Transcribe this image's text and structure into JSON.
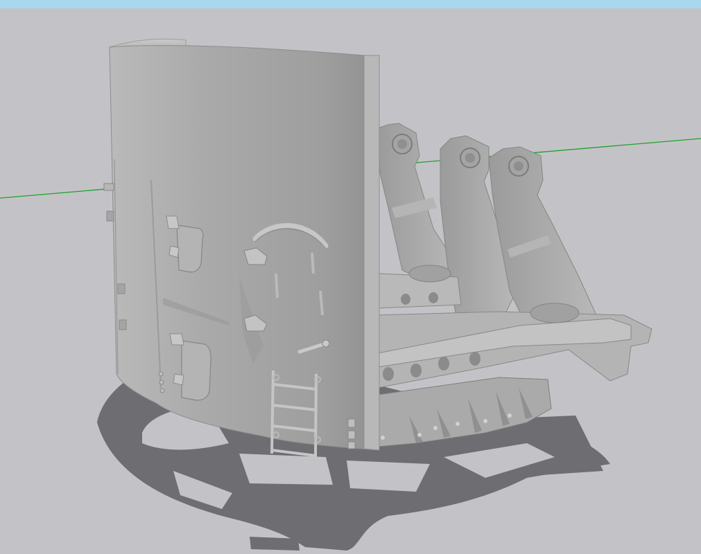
{
  "viewport": {
    "background_color": "#c3c3c7",
    "top_bar_color": "#a8d8ee",
    "axis_line_color": "#1fa02a",
    "shadow_color": "#6d6d72",
    "model_base_color": "#a6a7a6",
    "model_highlight_color": "#c2c3c2",
    "model_dark_color": "#7e7f7e"
  },
  "model": {
    "subject": "gun-mount-3d-model"
  }
}
